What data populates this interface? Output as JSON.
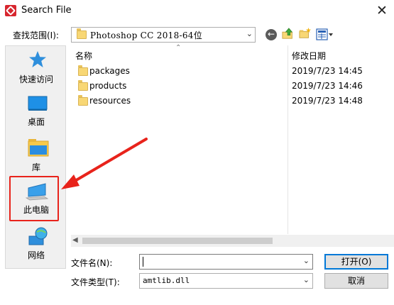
{
  "window": {
    "title": "Search File",
    "close": "✕"
  },
  "location": {
    "label": "查找范围(I):",
    "value": "Photoshop CC 2018-64位"
  },
  "toolbar": {
    "back": "←",
    "view_arrow": "▾"
  },
  "sidebar": {
    "items": [
      {
        "label": "快速访问",
        "icon": "star-icon"
      },
      {
        "label": "桌面",
        "icon": "desktop-icon"
      },
      {
        "label": "库",
        "icon": "library-icon"
      },
      {
        "label": "此电脑",
        "icon": "computer-icon"
      },
      {
        "label": "网络",
        "icon": "network-icon"
      }
    ]
  },
  "files": {
    "columns": {
      "name": "名称",
      "date": "修改日期"
    },
    "rows": [
      {
        "name": "packages",
        "date": "2019/7/23 14:45"
      },
      {
        "name": "products",
        "date": "2019/7/23 14:46"
      },
      {
        "name": "resources",
        "date": "2019/7/23 14:48"
      }
    ]
  },
  "form": {
    "filename_label": "文件名(N):",
    "filename_value": "",
    "filetype_label": "文件类型(T):",
    "filetype_value": "amtlib.dll"
  },
  "buttons": {
    "open": "打开(O)",
    "cancel": "取消"
  },
  "colors": {
    "annotation": "#e8231b",
    "accent": "#0078d7",
    "folder": "#f8d775"
  }
}
